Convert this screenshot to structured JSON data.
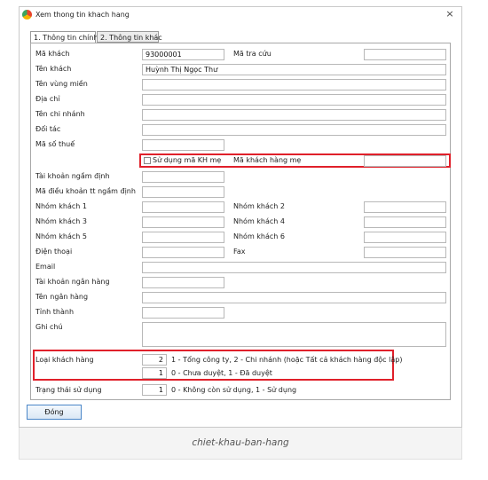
{
  "window": {
    "title": "Xem thong tin khach hang",
    "close_glyph": "×"
  },
  "tabs": [
    {
      "label": "1. Thông tin chính"
    },
    {
      "label": "2. Thông tin khác"
    }
  ],
  "form": {
    "ma_khach": {
      "label": "Mã khách",
      "value": "93000001"
    },
    "ma_tra_cuu": {
      "label": "Mã tra cứu",
      "value": ""
    },
    "ten_khach": {
      "label": "Tên khách",
      "value": "Huỳnh Thị Ngọc Thư"
    },
    "ten_vung_mien": {
      "label": "Tên vùng miền",
      "value": ""
    },
    "dia_chi": {
      "label": "Địa chỉ",
      "value": ""
    },
    "ten_chi_nhanh": {
      "label": "Tên chi nhánh",
      "value": ""
    },
    "doi_tac": {
      "label": "Đối tác",
      "value": ""
    },
    "ma_so_thue": {
      "label": "Mã số thuế",
      "value": ""
    },
    "su_dung_ma_kh_me": {
      "label": "Sử dụng mã KH mẹ",
      "checked": false
    },
    "ma_khach_hang_me": {
      "label": "Mã khách hàng mẹ",
      "value": ""
    },
    "tai_khoan_ngam_dinh": {
      "label": "Tài khoản ngầm định",
      "value": ""
    },
    "ma_dieu_khoan": {
      "label": "Mã điều khoản tt ngầm định",
      "value": ""
    },
    "nhom_khach_1": {
      "label": "Nhóm khách 1",
      "value": ""
    },
    "nhom_khach_2": {
      "label": "Nhóm khách 2",
      "value": ""
    },
    "nhom_khach_3": {
      "label": "Nhóm khách 3",
      "value": ""
    },
    "nhom_khach_4": {
      "label": "Nhóm khách 4",
      "value": ""
    },
    "nhom_khach_5": {
      "label": "Nhóm khách 5",
      "value": ""
    },
    "nhom_khach_6": {
      "label": "Nhóm khách 6",
      "value": ""
    },
    "dien_thoai": {
      "label": "Điện thoại",
      "value": ""
    },
    "fax": {
      "label": "Fax",
      "value": ""
    },
    "email": {
      "label": "Email",
      "value": ""
    },
    "tai_khoan_ngan_hang": {
      "label": "Tài khoản ngân hàng",
      "value": ""
    },
    "ten_ngan_hang": {
      "label": "Tên ngân hàng",
      "value": ""
    },
    "tinh_thanh": {
      "label": "Tỉnh thành",
      "value": ""
    },
    "ghi_chu": {
      "label": "Ghi chú",
      "value": ""
    },
    "loai_khach_hang": {
      "label": "Loại khách hàng",
      "value": "2",
      "hint": "1 - Tổng công ty, 2 - Chi nhánh (hoặc Tất cả khách hàng độc lập)"
    },
    "trang_thai_duyet": {
      "value": "1",
      "hint": "0 - Chưa duyệt, 1 - Đã duyệt"
    },
    "trang_thai_su_dung": {
      "label": "Trạng thái sử dụng",
      "value": "1",
      "hint": "0 - Không còn sử dụng, 1 - Sử dụng"
    }
  },
  "buttons": {
    "close_label": "Đóng"
  },
  "caption": "chiet-khau-ban-hang",
  "colors": {
    "highlight": "#e0202a",
    "button_border": "#4a86c8"
  }
}
